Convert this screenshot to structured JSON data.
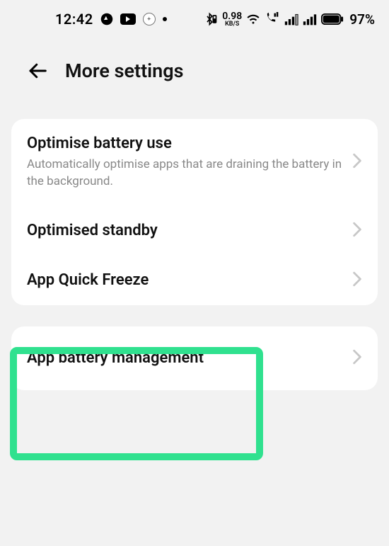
{
  "status": {
    "time": "12:42",
    "net_speed_value": "0.98",
    "net_speed_unit": "KB/S",
    "battery_pct": "97%"
  },
  "header": {
    "title": "More settings"
  },
  "items": {
    "optimise": {
      "title": "Optimise battery use",
      "subtitle": "Automatically optimise apps that are draining the battery in the background."
    },
    "standby": {
      "title": "Optimised standby"
    },
    "freeze": {
      "title": "App Quick Freeze"
    },
    "app_batt": {
      "title": "App battery management"
    }
  }
}
